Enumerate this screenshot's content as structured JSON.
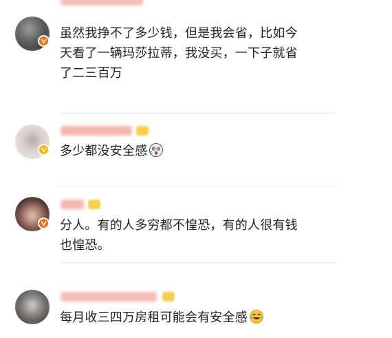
{
  "comments": [
    {
      "text_lines": [
        "虽然我挣不了多少钱，但是我会省，比如今",
        "天看了一辆玛莎拉蒂，我没买，一下子就省",
        "了二三百万"
      ],
      "badge": "orange-v-badge",
      "avatar_color": "#5b5f5a"
    },
    {
      "text_lines": [
        "多少都没安全感"
      ],
      "emoji": "shocked-face-emoji",
      "badge": "yellow-v-badge",
      "avatar_color": "#d9d3cf"
    },
    {
      "text_lines": [
        "分人。有的人多穷都不惶恐，有的人很有钱",
        "也惶恐。"
      ],
      "badge": "orange-v-badge",
      "avatar_color": "#6b4a44"
    },
    {
      "text_lines": [
        "每月收三四万房租可能会有安全感"
      ],
      "emoji": "laughing-tears-emoji",
      "avatar_color": "#5f5e5c"
    }
  ],
  "colors": {
    "text": "#222222",
    "divider": "#ececec",
    "verified_orange": "#f06d1a",
    "verified_yellow": "#f4b400",
    "name_blur": "#f6a9a3"
  }
}
